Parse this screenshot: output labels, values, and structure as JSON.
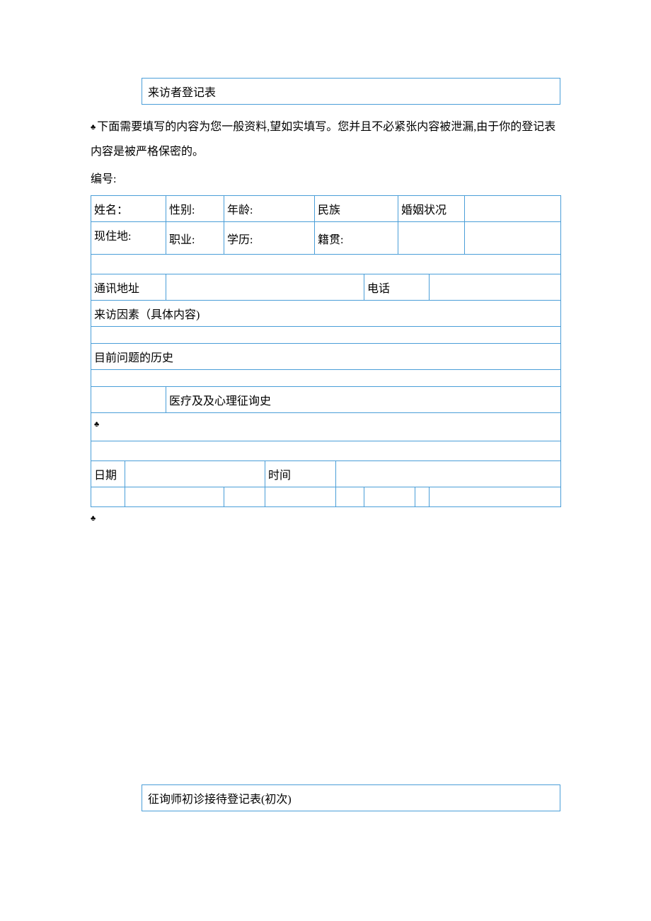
{
  "title1": "来访者登记表",
  "intro": "下面需要填写的内容为您一般资料,望如实填写。您并且不必紧张内容被泄漏,由于你的登记表内容是被严格保密的。",
  "serial_label": "编号:",
  "row1": {
    "name": "姓名：",
    "gender": "性别:",
    "age": "年龄:",
    "ethnic": "民族",
    "marital": "婚姻状况"
  },
  "row2": {
    "residence": "现住地:",
    "occupation": "职业:",
    "education": "学历:",
    "origin": "籍贯:"
  },
  "row_addr": {
    "addr": "通讯地址",
    "phone": "电话"
  },
  "row_reason": "来访因素（具体内容)",
  "row_history": "目前问题的历史",
  "row_medical": "医疗及及心理征询史",
  "row_date": {
    "date": "日期",
    "time": "时间"
  },
  "title2": "征询师初诊接待登记表(初次)",
  "glyph": "♣"
}
